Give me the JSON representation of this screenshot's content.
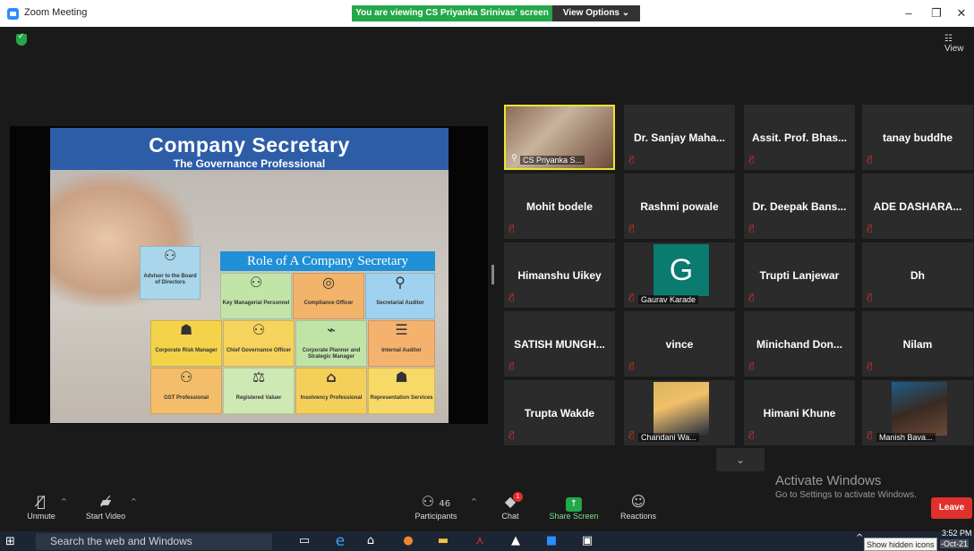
{
  "window": {
    "title": "Zoom Meeting",
    "viewing_banner": "You are viewing CS Priyanka Srinivas' screen",
    "view_options": "View Options ⌄",
    "minimize": "–",
    "restore": "❐",
    "close": "✕"
  },
  "top_bar": {
    "view_label": "☷ View"
  },
  "slide": {
    "title": "Company Secretary",
    "subtitle": "The Governance Professional",
    "role_banner": "Role of A Company Secretary",
    "blocks": [
      "Advisor to the Board of Directors",
      "Key Managerial Personnel",
      "Compliance Officer",
      "Secretarial Auditor",
      "Corporate Risk Manager",
      "Chief Governance Officer",
      "Corporate Planner and Strategic Manager",
      "Internal Auditor",
      "GST Professional",
      "Registered Valuer",
      "Insolvency Professional",
      "Representation Services"
    ]
  },
  "gallery": [
    {
      "name": "CS Priyanka S...",
      "kind": "video"
    },
    {
      "name": "Dr. Sanjay Maha...",
      "kind": "text"
    },
    {
      "name": "Assit. Prof. Bhas...",
      "kind": "text"
    },
    {
      "name": "tanay buddhe",
      "kind": "text"
    },
    {
      "name": "Mohit bodele",
      "kind": "text"
    },
    {
      "name": "Rashmi powale",
      "kind": "text"
    },
    {
      "name": "Dr. Deepak Bans...",
      "kind": "text"
    },
    {
      "name": "ADE DASHARA...",
      "kind": "text"
    },
    {
      "name": "Himanshu Uikey",
      "kind": "text"
    },
    {
      "name": "Gaurav Karade",
      "kind": "avatar",
      "initial": "G"
    },
    {
      "name": "Trupti Lanjewar",
      "kind": "text"
    },
    {
      "name": "Dh",
      "kind": "text"
    },
    {
      "name": "SATISH MUNGH...",
      "kind": "text"
    },
    {
      "name": "vince",
      "kind": "text"
    },
    {
      "name": "Minichand Don...",
      "kind": "text"
    },
    {
      "name": "Nilam",
      "kind": "text"
    },
    {
      "name": "Trupta Wakde",
      "kind": "text"
    },
    {
      "name": "Chandani Wa...",
      "kind": "photo"
    },
    {
      "name": "Himani Khune",
      "kind": "text"
    },
    {
      "name": "Manish Bava...",
      "kind": "photo"
    }
  ],
  "watermark": {
    "line1": "Activate Windows",
    "line2": "Go to Settings to activate Windows."
  },
  "toolbar": {
    "unmute": "Unmute",
    "start_video": "Start Video",
    "participants": "Participants",
    "participants_count": "46",
    "chat": "Chat",
    "chat_badge": "1",
    "share_screen": "Share Screen",
    "reactions": "Reactions",
    "leave": "Leave"
  },
  "taskbar": {
    "search_placeholder": "Search the web and Windows",
    "tooltip": "Show hidden icons",
    "time": "3:52 PM",
    "date": "-Oct-21"
  }
}
